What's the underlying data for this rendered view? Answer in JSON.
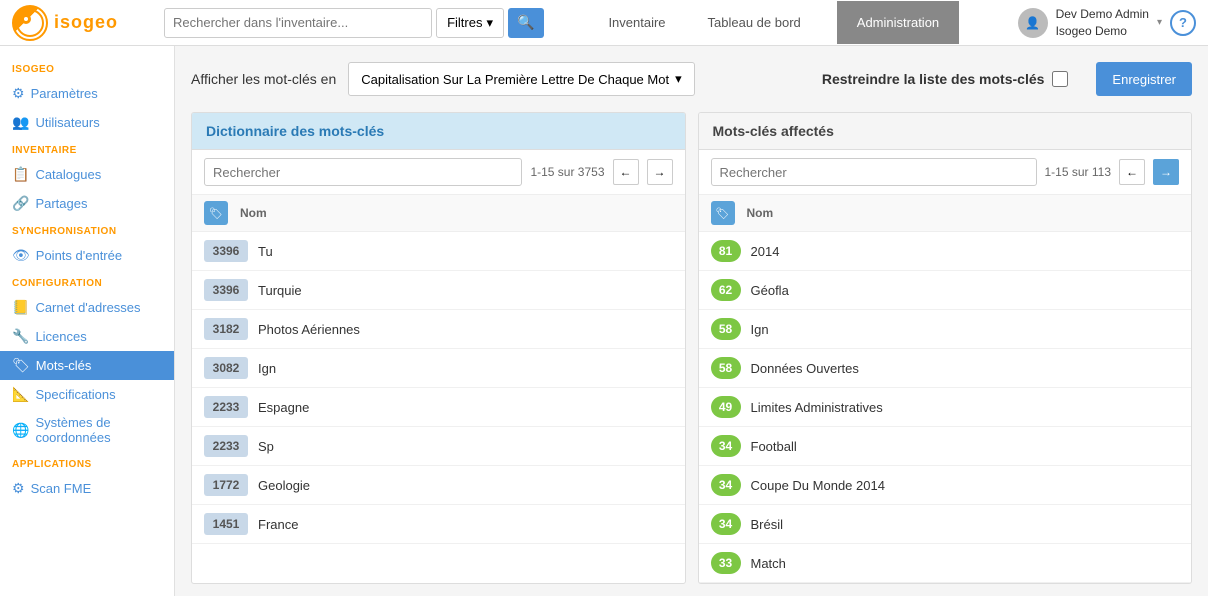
{
  "logo": {
    "text": "isogeo"
  },
  "topnav": {
    "search_placeholder": "Rechercher dans l'inventaire...",
    "filter_label": "Filtres",
    "links": [
      {
        "label": "Inventaire",
        "active": false
      },
      {
        "label": "Tableau de bord",
        "active": false
      },
      {
        "label": "Administration",
        "active": true
      }
    ],
    "user": {
      "name_line1": "Dev Demo Admin",
      "name_line2": "Isogeo Demo"
    },
    "help_label": "?"
  },
  "sidebar": {
    "sections": [
      {
        "title": "ISOGEO",
        "items": [
          {
            "label": "Paramètres",
            "icon": "⚙",
            "active": false
          },
          {
            "label": "Utilisateurs",
            "icon": "👥",
            "active": false
          }
        ]
      },
      {
        "title": "INVENTAIRE",
        "items": [
          {
            "label": "Catalogues",
            "icon": "📋",
            "active": false
          },
          {
            "label": "Partages",
            "icon": "🔗",
            "active": false
          }
        ]
      },
      {
        "title": "SYNCHRONISATION",
        "items": [
          {
            "label": "Points d'entrée",
            "icon": "👁",
            "active": false
          }
        ]
      },
      {
        "title": "CONFIGURATION",
        "items": [
          {
            "label": "Carnet d'adresses",
            "icon": "📒",
            "active": false
          },
          {
            "label": "Licences",
            "icon": "🔧",
            "active": false
          },
          {
            "label": "Mots-clés",
            "icon": "🏷",
            "active": true
          },
          {
            "label": "Specifications",
            "icon": "📐",
            "active": false
          },
          {
            "label": "Systèmes de coordonnées",
            "icon": "🌐",
            "active": false
          }
        ]
      },
      {
        "title": "APPLICATIONS",
        "items": [
          {
            "label": "Scan FME",
            "icon": "⚙",
            "active": false
          }
        ]
      }
    ]
  },
  "main": {
    "header": {
      "label": "Afficher les mot-clés en",
      "dropdown_value": "Capitalisation Sur La Première Lettre De Chaque Mot",
      "restrict_label": "Restreindre la liste des mots-clés",
      "save_label": "Enregistrer"
    },
    "dict_panel": {
      "title": "Dictionnaire des mots-clés",
      "search_placeholder": "Rechercher",
      "pagination": "1-15 sur 3753",
      "column_name": "Nom",
      "rows": [
        {
          "count": "3396",
          "name": "Tu"
        },
        {
          "count": "3396",
          "name": "Turquie"
        },
        {
          "count": "3182",
          "name": "Photos Aériennes"
        },
        {
          "count": "3082",
          "name": "Ign"
        },
        {
          "count": "2233",
          "name": "Espagne"
        },
        {
          "count": "2233",
          "name": "Sp"
        },
        {
          "count": "1772",
          "name": "Geologie"
        },
        {
          "count": "1451",
          "name": "France"
        }
      ]
    },
    "affected_panel": {
      "title": "Mots-clés affectés",
      "search_placeholder": "Rechercher",
      "pagination": "1-15 sur 113",
      "column_name": "Nom",
      "rows": [
        {
          "count": "81",
          "name": "2014"
        },
        {
          "count": "62",
          "name": "Géofla"
        },
        {
          "count": "58",
          "name": "Ign"
        },
        {
          "count": "58",
          "name": "Données Ouvertes"
        },
        {
          "count": "49",
          "name": "Limites Administratives"
        },
        {
          "count": "34",
          "name": "Football"
        },
        {
          "count": "34",
          "name": "Coupe Du Monde 2014"
        },
        {
          "count": "34",
          "name": "Brésil"
        },
        {
          "count": "33",
          "name": "Match"
        }
      ]
    }
  }
}
